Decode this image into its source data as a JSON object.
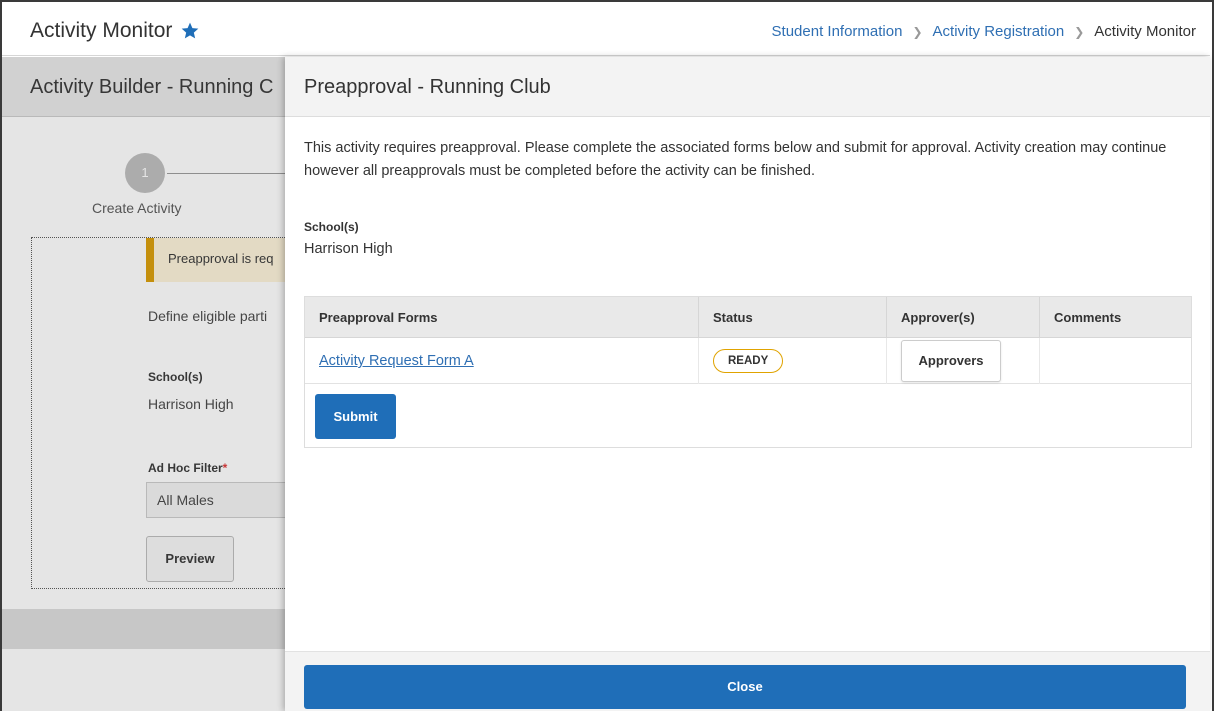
{
  "topbar": {
    "title": "Activity Monitor",
    "star_icon": "star-icon",
    "breadcrumb": [
      "Student Information",
      "Activity Registration",
      "Activity Monitor"
    ]
  },
  "background_page": {
    "header_title": "Activity Builder - Running C",
    "step": {
      "number": "1",
      "label": "Create Activity"
    },
    "warning_text": "Preapproval is req",
    "define_text": "Define eligible parti",
    "school_label": "School(s)",
    "school_value": "Harrison High",
    "adhoc_label": "Ad Hoc Filter",
    "adhoc_required": "*",
    "adhoc_value": "All Males",
    "preview_label": "Preview"
  },
  "modal": {
    "title": "Preapproval - Running Club",
    "description": "This activity requires preapproval. Please complete the associated forms below and submit for approval. Activity creation may continue however all preapprovals must be completed before the activity can be finished.",
    "school_label": "School(s)",
    "school_value": "Harrison High",
    "table": {
      "headers": [
        "Preapproval Forms",
        "Status",
        "Approver(s)",
        "Comments"
      ],
      "rows": [
        {
          "form": "Activity Request Form A",
          "status": "READY",
          "approver_button": "Approvers",
          "comments": ""
        }
      ]
    },
    "submit_label": "Submit",
    "close_label": "Close"
  },
  "colors": {
    "primary_button": "#1f6eb8",
    "link": "#2f6fb3",
    "status_border": "#e0a300",
    "warning_accent": "#d99a00"
  }
}
